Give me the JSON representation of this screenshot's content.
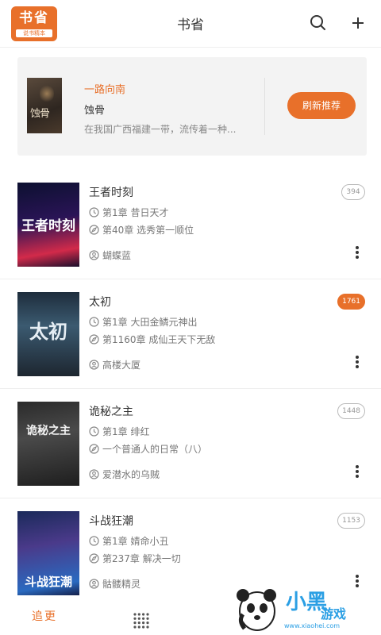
{
  "header": {
    "logo_line1": "书省",
    "logo_line2": "说书精本",
    "title": "书省"
  },
  "recommend": {
    "cover_text": "蚀骨",
    "label": "一路向南",
    "book_name": "蚀骨",
    "description": "在我国广西福建一带，流传着一种...",
    "refresh_label": "刷新推荐"
  },
  "books": [
    {
      "title": "王者时刻",
      "cover_text": "王者时刻",
      "first_chapter": "第1章 昔日天才",
      "latest_chapter": "第40章 选秀第一顺位",
      "author": "蝴蝶蓝",
      "count": "394",
      "highlight": false
    },
    {
      "title": "太初",
      "cover_text": "太初",
      "first_chapter": "第1章 大田金鳞元神出",
      "latest_chapter": "第1160章 成仙王天下无敌",
      "author": "高楼大厦",
      "count": "1761",
      "highlight": true
    },
    {
      "title": "诡秘之主",
      "cover_text": "诡秘之主",
      "first_chapter": "第1章 绯红",
      "latest_chapter": "一个普通人的日常（八）",
      "author": "爱潜水的乌贼",
      "count": "1448",
      "highlight": false
    },
    {
      "title": "斗战狂潮",
      "cover_text": "斗战狂潮",
      "first_chapter": "第1章 婧命小丑",
      "latest_chapter": "第237章 解决一切",
      "author": "骷髅精灵",
      "count": "1153",
      "highlight": false
    }
  ],
  "bottombar": {
    "follow_label": "追更"
  },
  "watermark": {
    "text": "小黑",
    "text2": "游戏",
    "url": "www.xiaohei.com"
  },
  "colors": {
    "accent": "#e8702a",
    "watermark": "#2b9fe4"
  }
}
